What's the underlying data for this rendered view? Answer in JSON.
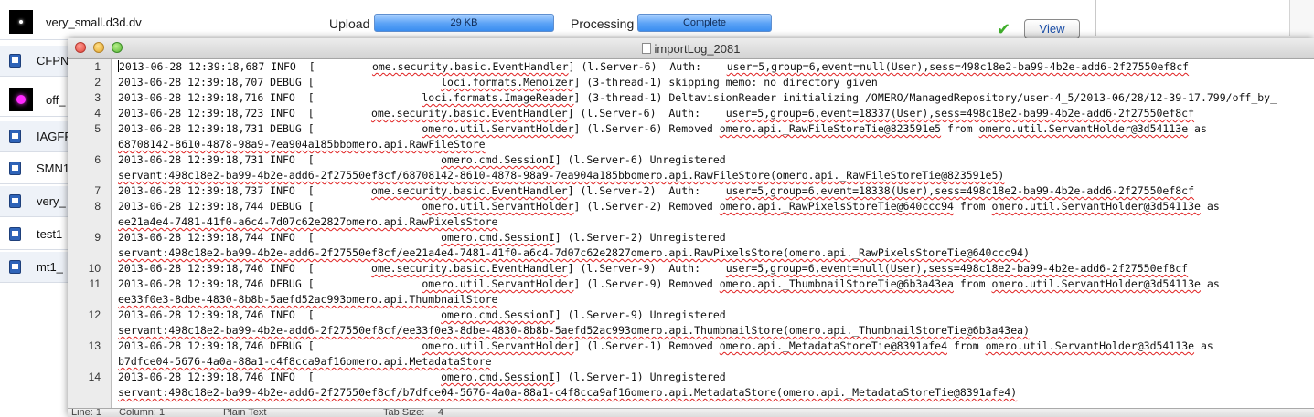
{
  "importer": {
    "top_row": {
      "file_name": "very_small.d3d.dv",
      "upload_label": "Upload",
      "upload_progress": "29 KB",
      "processing_label": "Processing",
      "processing_status": "Complete",
      "view_button": "View"
    },
    "rows": [
      {
        "name": "CFPN",
        "icon": "file-icon"
      },
      {
        "name": "off_",
        "icon": "magenta-thumbnail"
      },
      {
        "name": "IAGFF",
        "icon": "file-icon"
      },
      {
        "name": "SMN1",
        "icon": "file-icon"
      },
      {
        "name": "very_",
        "icon": "file-icon"
      },
      {
        "name": "test1",
        "icon": "file-icon"
      },
      {
        "name": "mt1_",
        "icon": "file-icon"
      }
    ]
  },
  "log_window": {
    "title": "importLog_2081",
    "lines": [
      {
        "num": "1",
        "text": "2013-06-28 12:39:18,687 INFO  [         ome.security.basic.EventHandler] (l.Server-6)  Auth:    user=5,group=6,event=null(User),sess=498c18e2-ba99-4b2e-add6-2f27550ef8cf"
      },
      {
        "num": "2",
        "text": "2013-06-28 12:39:18,707 DEBUG [                    loci.formats.Memoizer] (3-thread-1) skipping memo: no directory given"
      },
      {
        "num": "3",
        "text": "2013-06-28 12:39:18,716 INFO  [                 loci.formats.ImageReader] (3-thread-1) DeltavisionReader initializing /OMERO/ManagedRepository/user-4_5/2013-06/28/12-39-17.799/off_by_"
      },
      {
        "num": "4",
        "text": "2013-06-28 12:39:18,723 INFO  [         ome.security.basic.EventHandler] (l.Server-6)  Auth:    user=5,group=6,event=18337(User),sess=498c18e2-ba99-4b2e-add6-2f27550ef8cf"
      },
      {
        "num": "5",
        "text": "2013-06-28 12:39:18,731 DEBUG [                 omero.util.ServantHolder] (l.Server-6) Removed omero.api._RawFileStoreTie@823591e5 from omero.util.ServantHolder@3d54113e as"
      },
      {
        "num": "",
        "text": "68708142-8610-4878-98a9-7ea904a185bbomero.api.RawFileStore"
      },
      {
        "num": "6",
        "text": "2013-06-28 12:39:18,731 INFO  [                    omero.cmd.SessionI] (l.Server-6) Unregistered"
      },
      {
        "num": "",
        "text": "servant:498c18e2-ba99-4b2e-add6-2f27550ef8cf/68708142-8610-4878-98a9-7ea904a185bbomero.api.RawFileStore(omero.api._RawFileStoreTie@823591e5)"
      },
      {
        "num": "7",
        "text": "2013-06-28 12:39:18,737 INFO  [         ome.security.basic.EventHandler] (l.Server-2)  Auth:    user=5,group=6,event=18338(User),sess=498c18e2-ba99-4b2e-add6-2f27550ef8cf"
      },
      {
        "num": "8",
        "text": "2013-06-28 12:39:18,744 DEBUG [                 omero.util.ServantHolder] (l.Server-2) Removed omero.api._RawPixelsStoreTie@640ccc94 from omero.util.ServantHolder@3d54113e as"
      },
      {
        "num": "",
        "text": "ee21a4e4-7481-41f0-a6c4-7d07c62e2827omero.api.RawPixelsStore"
      },
      {
        "num": "9",
        "text": "2013-06-28 12:39:18,744 INFO  [                    omero.cmd.SessionI] (l.Server-2) Unregistered"
      },
      {
        "num": "",
        "text": "servant:498c18e2-ba99-4b2e-add6-2f27550ef8cf/ee21a4e4-7481-41f0-a6c4-7d07c62e2827omero.api.RawPixelsStore(omero.api._RawPixelsStoreTie@640ccc94)"
      },
      {
        "num": "10",
        "text": "2013-06-28 12:39:18,746 INFO  [         ome.security.basic.EventHandler] (l.Server-9)  Auth:    user=5,group=6,event=null(User),sess=498c18e2-ba99-4b2e-add6-2f27550ef8cf"
      },
      {
        "num": "11",
        "text": "2013-06-28 12:39:18,746 DEBUG [                 omero.util.ServantHolder] (l.Server-9) Removed omero.api._ThumbnailStoreTie@6b3a43ea from omero.util.ServantHolder@3d54113e as"
      },
      {
        "num": "",
        "text": "ee33f0e3-8dbe-4830-8b8b-5aefd52ac993omero.api.ThumbnailStore"
      },
      {
        "num": "12",
        "text": "2013-06-28 12:39:18,746 INFO  [                    omero.cmd.SessionI] (l.Server-9) Unregistered"
      },
      {
        "num": "",
        "text": "servant:498c18e2-ba99-4b2e-add6-2f27550ef8cf/ee33f0e3-8dbe-4830-8b8b-5aefd52ac993omero.api.ThumbnailStore(omero.api._ThumbnailStoreTie@6b3a43ea)"
      },
      {
        "num": "13",
        "text": "2013-06-28 12:39:18,746 DEBUG [                 omero.util.ServantHolder] (l.Server-1) Removed omero.api._MetadataStoreTie@8391afe4 from omero.util.ServantHolder@3d54113e as"
      },
      {
        "num": "",
        "text": "b7dfce04-5676-4a0a-88a1-c4f8cca9af16omero.api.MetadataStore"
      },
      {
        "num": "14",
        "text": "2013-06-28 12:39:18,746 INFO  [                    omero.cmd.SessionI] (l.Server-1) Unregistered"
      },
      {
        "num": "",
        "text": "servant:498c18e2-ba99-4b2e-add6-2f27550ef8cf/b7dfce04-5676-4a0a-88a1-c4f8cca9af16omero.api.MetadataStore(omero.api._MetadataStoreTie@8391afe4)"
      }
    ],
    "status": {
      "line": "Line: 1",
      "column": "Column: 1",
      "syntax": "Plain Text",
      "tab_size": "Tab Size:",
      "tab_value": "4"
    }
  }
}
